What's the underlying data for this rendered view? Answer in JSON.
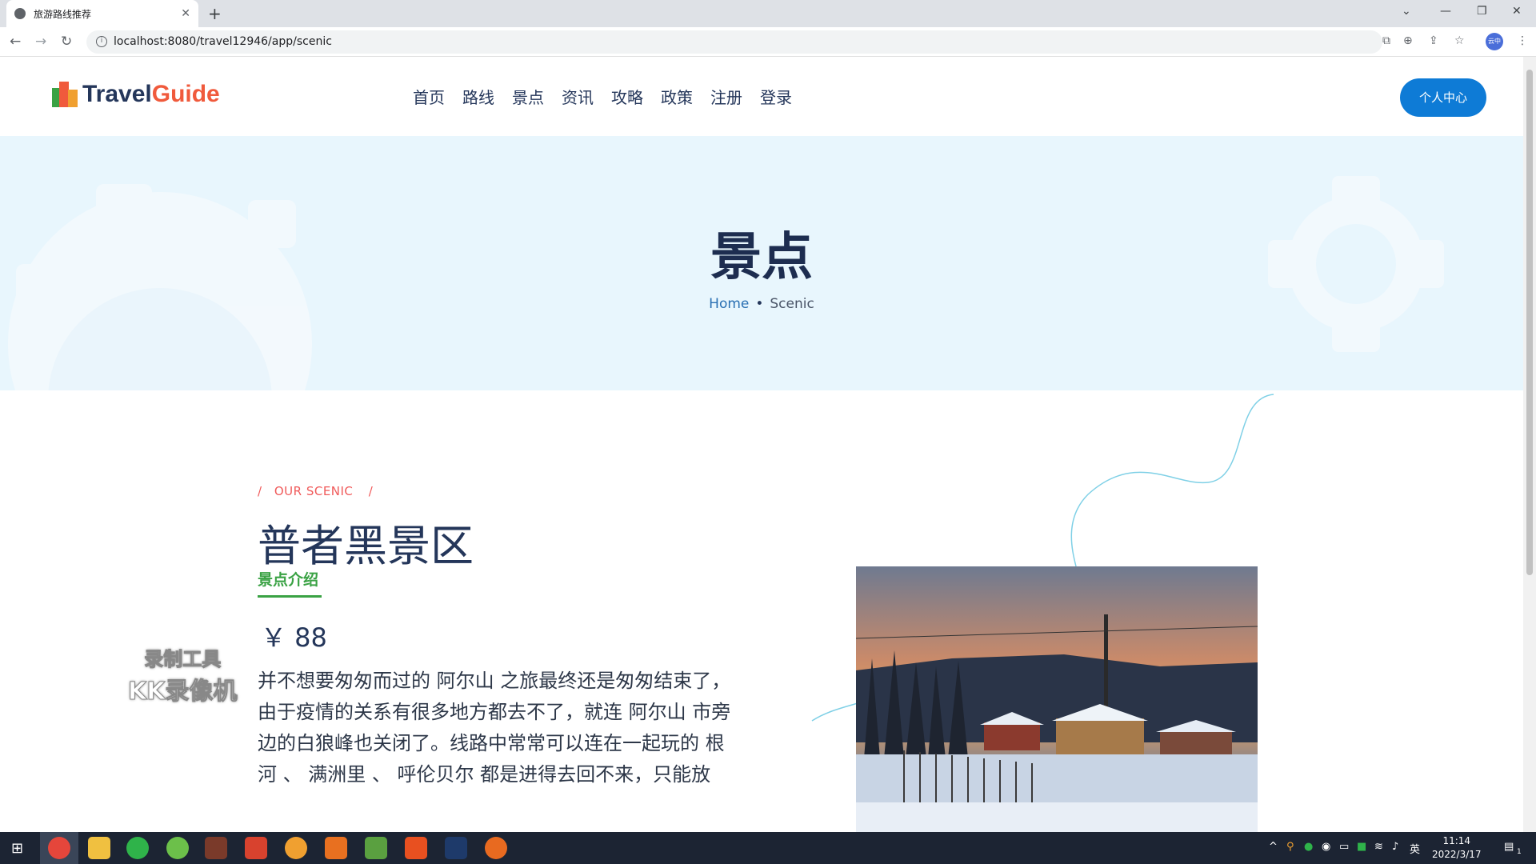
{
  "browser": {
    "tab_title": "旅游路线推荐",
    "url": "localhost:8080/travel12946/app/scenic",
    "profile_label": "云中"
  },
  "header": {
    "logo_part1": "Travel",
    "logo_part2": "Guide",
    "nav": [
      "首页",
      "路线",
      "景点",
      "资讯",
      "攻略",
      "政策",
      "注册",
      "登录"
    ],
    "user_center_label": "个人中心"
  },
  "hero": {
    "title": "景点",
    "breadcrumb_home": "Home",
    "breadcrumb_separator": "•",
    "breadcrumb_current": "Scenic"
  },
  "detail": {
    "kicker_slash_left": "/",
    "kicker_text": "OUR SCENIC",
    "kicker_slash_right": "/",
    "name": "普者黑景区",
    "intro_tab": "景点介绍",
    "price": "￥ 88",
    "description": "并不想要匆匆而过的 阿尔山 之旅最终还是匆匆结束了，由于疫情的关系有很多地方都去不了，就连 阿尔山 市旁边的白狼峰也关闭了。线路中常常可以连在一起玩的 根河 、 满洲里 、 呼伦贝尔 都是进得去回不来，只能放"
  },
  "watermark": {
    "line1": "录制工具",
    "line2": "KK录像机"
  },
  "taskbar": {
    "time": "11:14",
    "date": "2022/3/17",
    "ime": "英",
    "notification_count": "1"
  },
  "colors": {
    "brand_blue": "#0e7bd6",
    "navy": "#24365a",
    "accent_red": "#f05a3c",
    "accent_green": "#3aa244",
    "hero_bg": "#e8f6fd"
  }
}
